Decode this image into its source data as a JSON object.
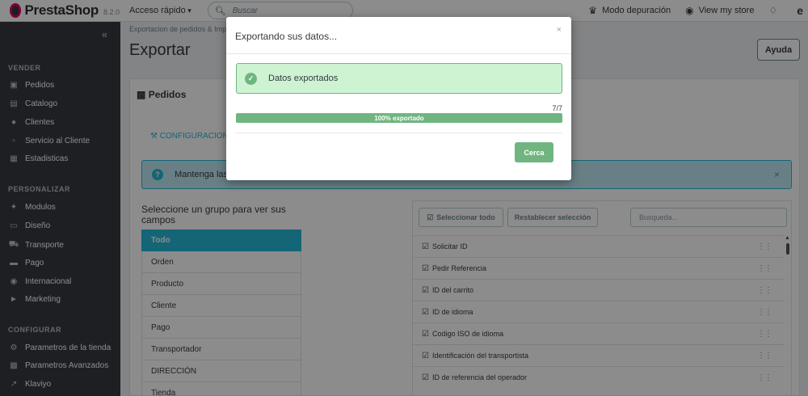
{
  "topbar": {
    "logo_text": "PrestaShop",
    "version": "8.2.0",
    "quick_access": "Acceso rápido",
    "search_placeholder": "Buscar",
    "debug_mode": "Modo depuración",
    "view_store": "View my store"
  },
  "sidebar": {
    "sections": [
      {
        "title": "VENDER",
        "items": [
          {
            "label": "Pedidos",
            "icon": "basket-icon"
          },
          {
            "label": "Catalogo",
            "icon": "store-icon"
          },
          {
            "label": "Clientes",
            "icon": "user-icon"
          },
          {
            "label": "Servicio al Cliente",
            "icon": "chat-icon"
          },
          {
            "label": "Estadisticas",
            "icon": "stats-icon"
          }
        ]
      },
      {
        "title": "PERSONALIZAR",
        "items": [
          {
            "label": "Modulos",
            "icon": "puzzle-icon"
          },
          {
            "label": "Diseño",
            "icon": "desktop-icon"
          },
          {
            "label": "Transporte",
            "icon": "truck-icon"
          },
          {
            "label": "Pago",
            "icon": "card-icon"
          },
          {
            "label": "Internacional",
            "icon": "globe-icon"
          },
          {
            "label": "Marketing",
            "icon": "megaphone-icon"
          }
        ]
      },
      {
        "title": "CONFIGURAR",
        "items": [
          {
            "label": "Parametros de la tienda",
            "icon": "gear-icon"
          },
          {
            "label": "Parametros Avanzados",
            "icon": "settings-box-icon"
          },
          {
            "label": "Klaviyo",
            "icon": "trend-icon"
          }
        ]
      }
    ]
  },
  "header": {
    "breadcrumb": "Exportacion de pedidos & Imp",
    "title": "Exportar",
    "help_label": "Ayuda"
  },
  "panel": {
    "title": "Pedidos",
    "config_link": "CONFIGURACIONE",
    "alert_text": "Mantenga las",
    "group_label": "Seleccione un grupo para ver sus campos",
    "groups": [
      "Todo",
      "Orden",
      "Producto",
      "Cliente",
      "Pago",
      "Transportador",
      "DIRECCIÓN",
      "Tienda"
    ],
    "select_all": "Seleccionar todo",
    "reset_selection": "Restablecer selección",
    "search_placeholder": "Busqueda...",
    "fields": [
      "Solicitar ID",
      "Pedir Referencia",
      "ID del carrito",
      "ID de idioma",
      "Codigo ISO de idioma",
      "Identificación del transportista",
      "ID de referencia del operador"
    ]
  },
  "modal": {
    "title": "Exportando sus datos...",
    "success_text": "Datos exportados",
    "progress_count": "7/7",
    "progress_label": "100% exportado",
    "progress_percent": 100,
    "close_button": "Cerca"
  },
  "colors": {
    "accent": "#25b9d7",
    "success": "#70b580",
    "sidebar": "#363a41"
  }
}
